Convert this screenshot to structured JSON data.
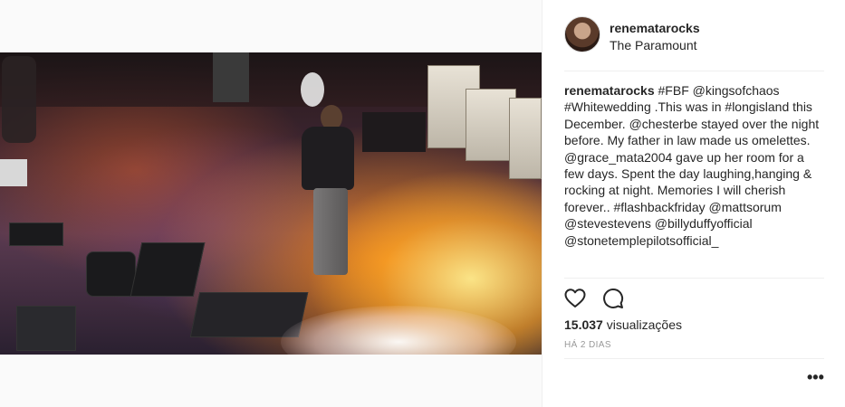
{
  "post": {
    "username": "renematarocks",
    "location": "The Paramount",
    "caption_user": "renematarocks",
    "caption_text": "#FBF @kingsofchaos #Whitewedding .This was in #longisland this December. @chesterbe stayed over the night before. My father in law made us omelettes. @grace_mata2004 gave up her room for a few days. Spent the day laughing,hanging & rocking at night. Memories I will cherish forever.. #flashbackfriday @mattsorum @stevestevens @billyduffyofficial @stonetemplepilotsofficial_",
    "views_count": "15.037",
    "views_label": "visualizações",
    "time_ago": "HÁ 2 DIAS",
    "more_glyph": "•••"
  },
  "icons": {
    "like": "heart-icon",
    "comment": "comment-icon",
    "more": "more-options-icon"
  }
}
